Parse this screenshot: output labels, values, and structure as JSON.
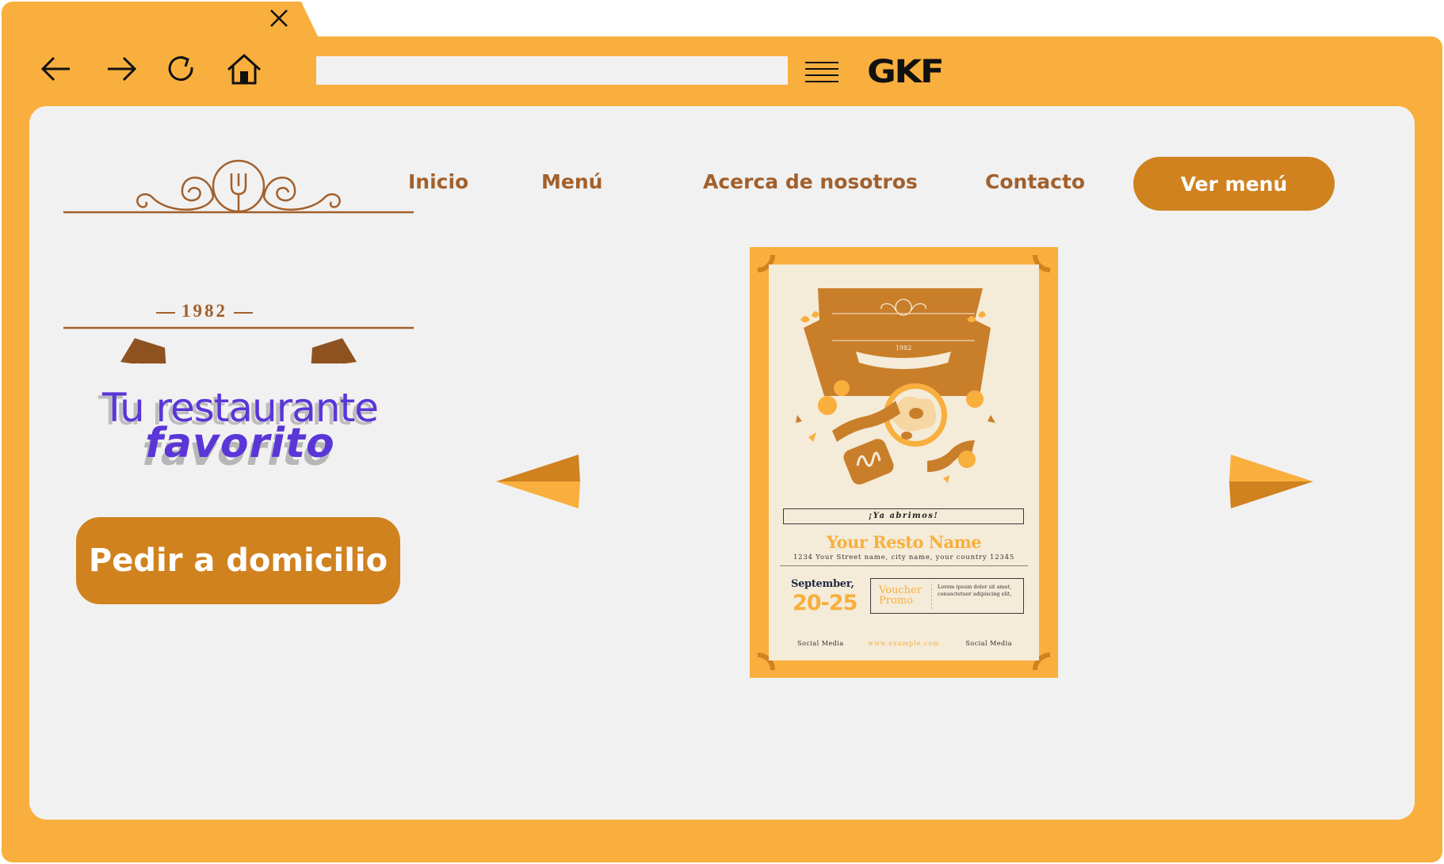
{
  "browser": {
    "address_value": "",
    "brand": "GKF",
    "icons": {
      "close": "close-icon",
      "back": "arrow-left-icon",
      "forward": "arrow-right-icon",
      "reload": "reload-icon",
      "home": "home-icon",
      "menu": "hamburger-menu-icon"
    },
    "colors": {
      "frame": "#F9AF3D",
      "viewport": "#F1F1F1"
    }
  },
  "nav": {
    "items": [
      {
        "label": "Inicio"
      },
      {
        "label": "Menú"
      },
      {
        "label": "Acerca de nosotros"
      },
      {
        "label": "Contacto"
      }
    ],
    "cta_label": "Ver menú"
  },
  "hero": {
    "year": "1982",
    "headline_line1": "Tu restaurante",
    "headline_line2": "favorito",
    "cta_label": "Pedir a domicilio",
    "colors": {
      "accent": "#D0821F",
      "headline": "#5A36D8",
      "brand_brown": "#A2602C"
    }
  },
  "carousel": {
    "prev_icon": "arrow-prev-icon",
    "next_icon": "arrow-next-icon"
  },
  "poster": {
    "year": "1982",
    "open_label": "¡Ya abrimos!",
    "name": "Your Resto Name",
    "address": "1234 Your Street name, city name, your country 12345",
    "month": "September,",
    "dates": "20-25",
    "voucher_line1": "Voucher",
    "voucher_line2": "Promo",
    "voucher_text": "Lorem ipsum dolor sit amet, consectetuer adipiscing elit,",
    "social_left": "Social Media",
    "url": "www.example.com",
    "social_right": "Social Media"
  }
}
